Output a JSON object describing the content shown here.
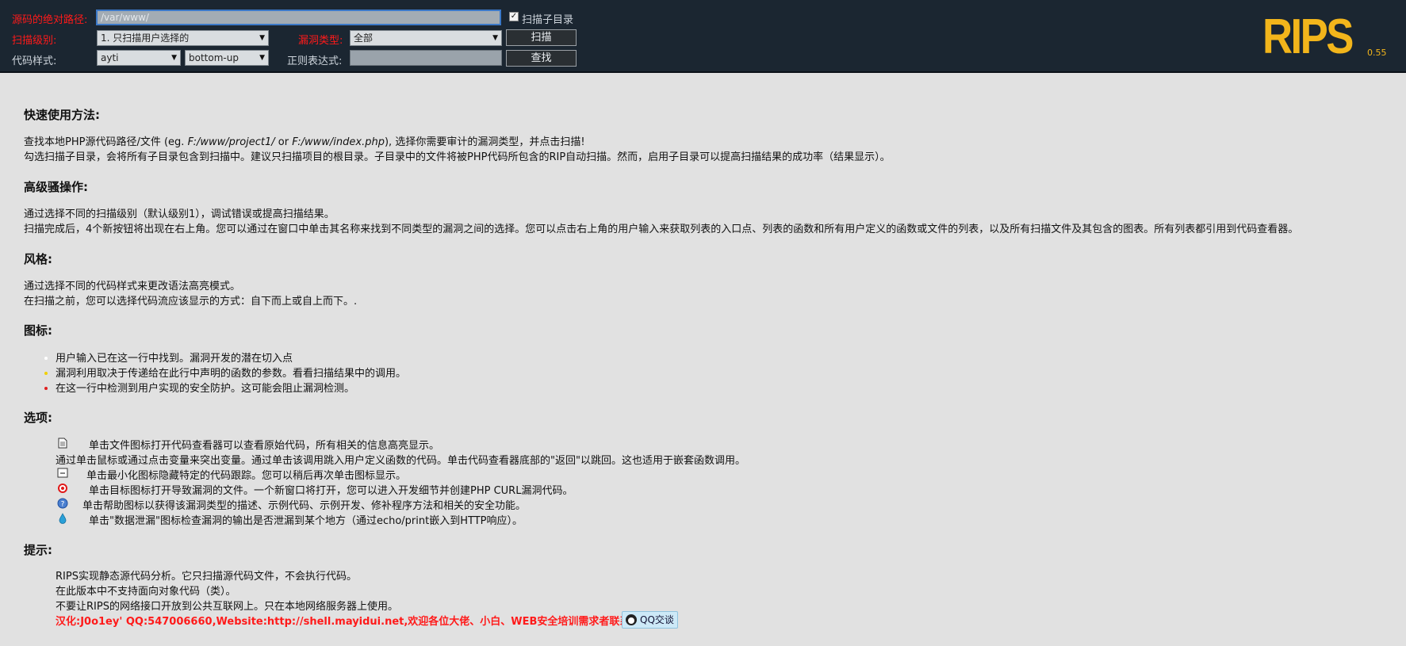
{
  "toolbar": {
    "path_label": "源码的绝对路径:",
    "path_value": "/var/www/",
    "subdirs_label": "扫描子目录",
    "subdirs_checked": true,
    "scan_level_label": "扫描级别:",
    "scan_level_value": "1. 只扫描用户选择的",
    "vuln_type_label": "漏洞类型:",
    "vuln_type_value": "全部",
    "scan_button": "扫描",
    "code_style_label": "代码样式:",
    "code_style_value": "ayti",
    "flow_value": "bottom-up",
    "regex_label": "正则表达式:",
    "regex_value": "",
    "search_button": "查找"
  },
  "logo": {
    "text": "RIPS",
    "version": "0.55",
    "color": "#f2b51b"
  },
  "sections": {
    "quick": {
      "title": "快速使用方法:",
      "line1_a": "查找本地PHP源代码路径/文件 (eg. ",
      "line1_b": "F:/www/project1/",
      "line1_c": " or ",
      "line1_d": "F:/www/index.php",
      "line1_e": "), 选择你需要审计的漏洞类型，并点击扫描!",
      "line2": "勾选扫描子目录，会将所有子目录包含到扫描中。建议只扫描项目的根目录。子目录中的文件将被PHP代码所包含的RIP自动扫描。然而，启用子目录可以提高扫描结果的成功率（结果显示）。"
    },
    "advanced": {
      "title": "高级骚操作:",
      "line1": "通过选择不同的扫描级别（默认级别1），调试错误或提高扫描结果。",
      "line2": "扫描完成后，4个新按钮将出现在右上角。您可以通过在窗口中单击其名称来找到不同类型的漏洞之间的选择。您可以点击右上角的用户输入来获取列表的入口点、列表的函数和所有用户定义的函数或文件的列表，以及所有扫描文件及其包含的图表。所有列表都引用到代码查看器。"
    },
    "style": {
      "title": "风格:",
      "line1": "通过选择不同的代码样式来更改语法高亮模式。",
      "line2": "在扫描之前，您可以选择代码流应该显示的方式：自下而上或自上而下。."
    },
    "icons": {
      "title": "图标:",
      "items": [
        {
          "text": "用户输入已在这一行中找到。漏洞开发的潜在切入点",
          "color": "#ffffff"
        },
        {
          "text": "漏洞利用取决于传递给在此行中声明的函数的参数。看看扫描结果中的调用。",
          "color": "#f0d000"
        },
        {
          "text": "在这一行中检测到用户实现的安全防护。这可能会阻止漏洞检测。",
          "color": "#e02020"
        }
      ]
    },
    "options": {
      "title": "选项:",
      "file": "单击文件图标打开代码查看器可以查看原始代码，所有相关的信息高亮显示。",
      "hover": "通过单击鼠标或通过点击变量来突出变量。通过单击该调用跳入用户定义函数的代码。单击代码查看器底部的\"返回\"以跳回。这也适用于嵌套函数调用。",
      "minimize": "单击最小化图标隐藏特定的代码跟踪。您可以稍后再次单击图标显示。",
      "target": "单击目标图标打开导致漏洞的文件。一个新窗口将打开，您可以进入开发细节并创建PHP CURL漏洞代码。",
      "help": "单击帮助图标以获得该漏洞类型的描述、示例代码、示例开发、修补程序方法和相关的安全功能。",
      "leak": "单击\"数据泄漏\"图标检查漏洞的输出是否泄漏到某个地方（通过echo/print嵌入到HTTP响应）。"
    },
    "hints": {
      "title": "提示:",
      "line1": "RIPS实现静态源代码分析。它只扫描源代码文件，不会执行代码。",
      "line2": "在此版本中不支持面向对象代码（类）。",
      "line3": "不要让RIPS的网络接口开放到公共互联网上。只在本地网络服务器上使用。",
      "credit": "汉化:J0o1ey' QQ:547006660,Website:http://shell.mayidui.net,欢迎各位大佬、小白、WEB安全培训需求者联系我",
      "qq_button": "QQ交谈"
    }
  }
}
